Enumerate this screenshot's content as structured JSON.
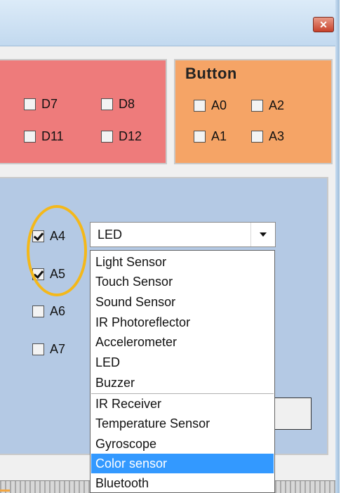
{
  "window": {
    "close_glyph": "✕"
  },
  "pin_panel": {
    "items": [
      {
        "label": "D7",
        "checked": false
      },
      {
        "label": "D8",
        "checked": false
      },
      {
        "label": "D11",
        "checked": false
      },
      {
        "label": "D12",
        "checked": false
      }
    ]
  },
  "button_panel": {
    "title": "Button",
    "items": [
      {
        "label": "A0",
        "checked": false
      },
      {
        "label": "A2",
        "checked": false
      },
      {
        "label": "A1",
        "checked": false
      },
      {
        "label": "A3",
        "checked": false
      }
    ]
  },
  "analog_panel": {
    "items": [
      {
        "label": "A4",
        "checked": true
      },
      {
        "label": "A5",
        "checked": true
      },
      {
        "label": "A6",
        "checked": false
      },
      {
        "label": "A7",
        "checked": false
      }
    ],
    "combo": {
      "value": "LED"
    }
  },
  "dropdown": {
    "items": [
      "Light Sensor",
      "Touch Sensor",
      "Sound Sensor",
      "IR Photoreflector",
      "Accelerometer",
      "LED",
      "Buzzer",
      "IR Receiver",
      "Temperature Sensor",
      "Gyroscope",
      "Color sensor",
      "Bluetooth"
    ],
    "selected_item": "Color sensor"
  },
  "colors": {
    "pin_panel": "#ee7b7b",
    "button_panel": "#f5a466",
    "analog_panel": "#b4c9e4",
    "selection": "#3399ff",
    "highlight_circle": "#f4b81a"
  }
}
